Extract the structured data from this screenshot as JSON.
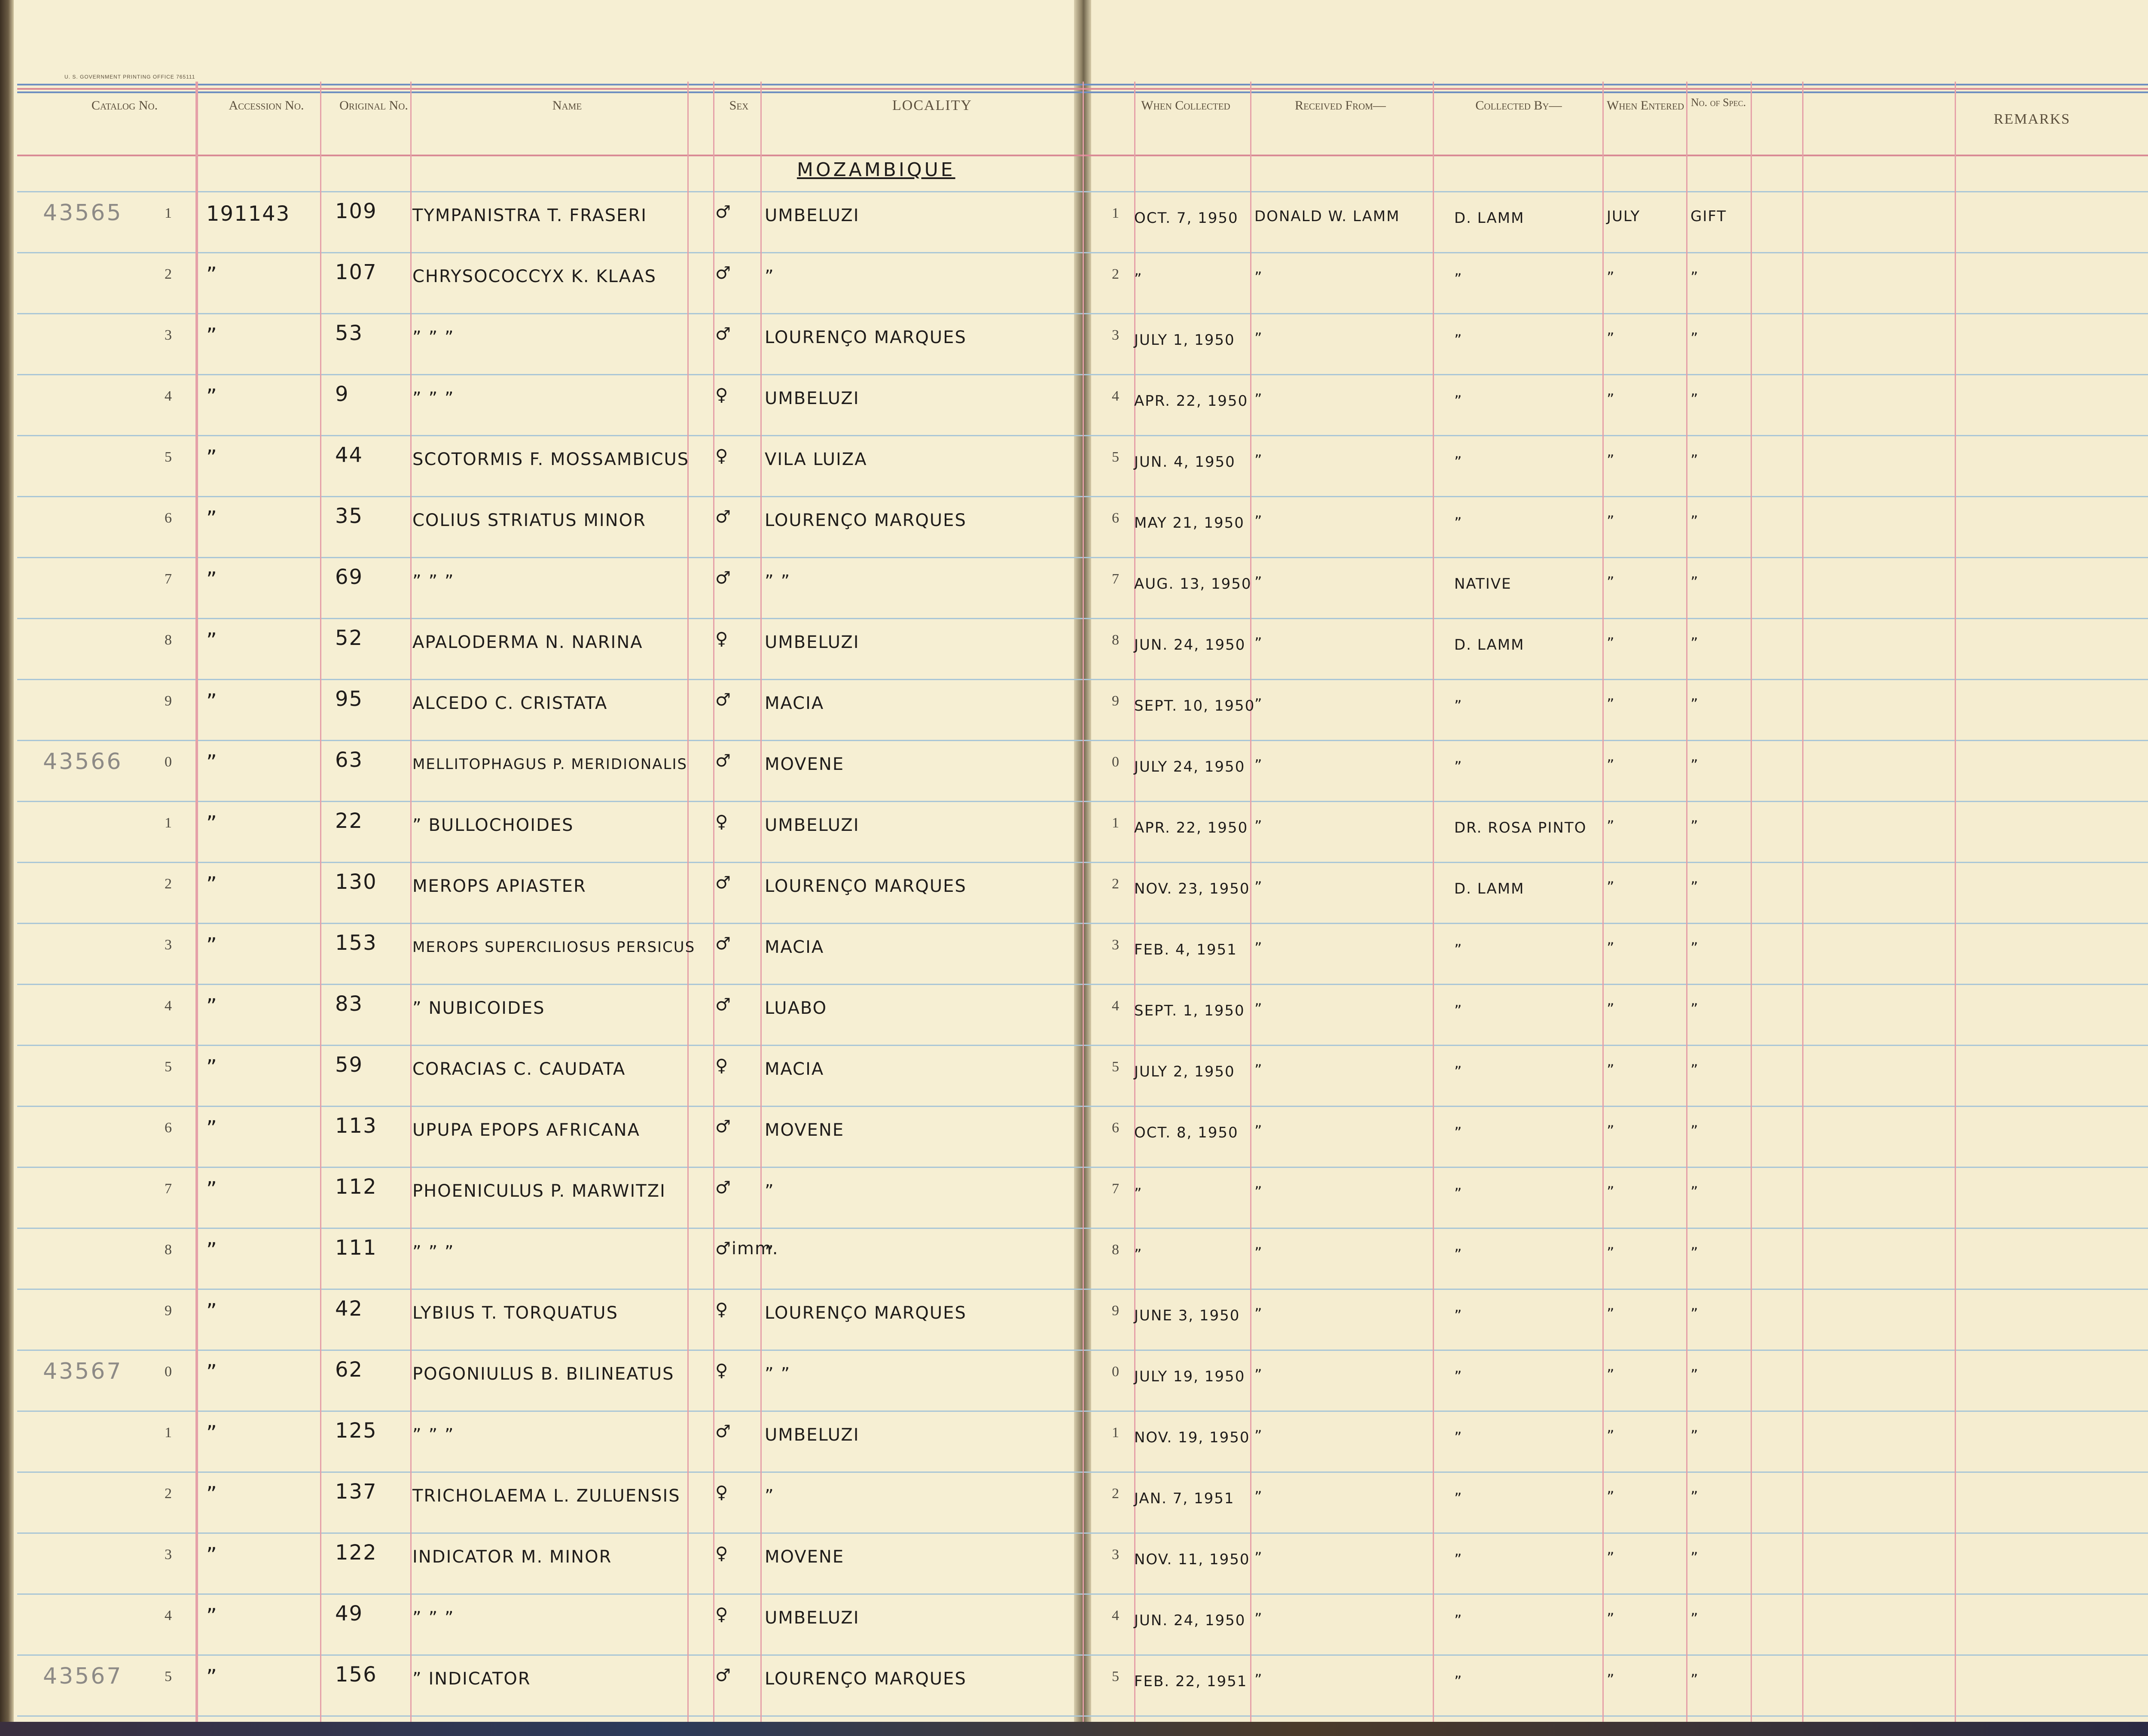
{
  "imprint": "U. S. GOVERNMENT PRINTING OFFICE   765111",
  "headers": {
    "catalog": "Catalog No.",
    "accession": "Accession No.",
    "original": "Original No.",
    "name": "Name",
    "sex": "Sex",
    "locality": "LOCALITY",
    "when_collected": "When Collected",
    "received_from": "Received From—",
    "collected_by": "Collected By—",
    "when_entered": "When Entered",
    "no_of_spec": "No. of Spec.",
    "remarks": "REMARKS"
  },
  "locality_heading": "MOZAMBIQUE",
  "rows": [
    {
      "catalog": "43565",
      "n": "1",
      "acc": "191143",
      "orig": "109",
      "name": "TYMPANISTRA T. FRASERI",
      "sex": "♂",
      "loc": "UMBELUZI",
      "rn": "1",
      "date": "OCT. 7, 1950",
      "recv": "DONALD W. LAMM",
      "coll": "D. LAMM",
      "entered": "JULY",
      "spec": "GIFT"
    },
    {
      "catalog": "",
      "n": "2",
      "acc": "”",
      "orig": "107",
      "name": "CHRYSOCOCCYX K. KLAAS",
      "sex": "♂",
      "loc": "”",
      "rn": "2",
      "date": "”",
      "recv": "”",
      "coll": "”",
      "entered": "”",
      "spec": "”"
    },
    {
      "catalog": "",
      "n": "3",
      "acc": "”",
      "orig": "53",
      "name": "”   ”   ”",
      "sex": "♂",
      "loc": "LOURENÇO MARQUES",
      "rn": "3",
      "date": "JULY 1, 1950",
      "recv": "”",
      "coll": "”",
      "entered": "”",
      "spec": "”"
    },
    {
      "catalog": "",
      "n": "4",
      "acc": "”",
      "orig": "9",
      "name": "”   ”   ”",
      "sex": "♀",
      "loc": "UMBELUZI",
      "rn": "4",
      "date": "APR. 22, 1950",
      "recv": "”",
      "coll": "”",
      "entered": "”",
      "spec": "”"
    },
    {
      "catalog": "",
      "n": "5",
      "acc": "”",
      "orig": "44",
      "name": "SCOTORMIS F. MOSSAMBICUS",
      "sex": "♀",
      "loc": "VILA LUIZA",
      "rn": "5",
      "date": "JUN. 4, 1950",
      "recv": "”",
      "coll": "”",
      "entered": "”",
      "spec": "”"
    },
    {
      "catalog": "",
      "n": "6",
      "acc": "”",
      "orig": "35",
      "name": "COLIUS STRIATUS MINOR",
      "sex": "♂",
      "loc": "LOURENÇO MARQUES",
      "rn": "6",
      "date": "MAY 21, 1950",
      "recv": "”",
      "coll": "”",
      "entered": "”",
      "spec": "”"
    },
    {
      "catalog": "",
      "n": "7",
      "acc": "”",
      "orig": "69",
      "name": "”   ”   ”",
      "sex": "♂",
      "loc": "”   ”",
      "rn": "7",
      "date": "AUG. 13, 1950",
      "recv": "”",
      "coll": "NATIVE",
      "entered": "”",
      "spec": "”"
    },
    {
      "catalog": "",
      "n": "8",
      "acc": "”",
      "orig": "52",
      "name": "APALODERMA N. NARINA",
      "sex": "♀",
      "loc": "UMBELUZI",
      "rn": "8",
      "date": "JUN. 24, 1950",
      "recv": "”",
      "coll": "D. LAMM",
      "entered": "”",
      "spec": "”"
    },
    {
      "catalog": "",
      "n": "9",
      "acc": "”",
      "orig": "95",
      "name": "ALCEDO C. CRISTATA",
      "sex": "♂",
      "loc": "MACIA",
      "rn": "9",
      "date": "SEPT. 10, 1950",
      "recv": "”",
      "coll": "”",
      "entered": "”",
      "spec": "”"
    },
    {
      "catalog": "43566",
      "n": "0",
      "acc": "”",
      "orig": "63",
      "name": "MELLITOPHAGUS P. MERIDIONALIS",
      "sex": "♂",
      "loc": "MOVENE",
      "rn": "0",
      "date": "JULY 24, 1950",
      "recv": "”",
      "coll": "”",
      "entered": "”",
      "spec": "”"
    },
    {
      "catalog": "",
      "n": "1",
      "acc": "”",
      "orig": "22",
      "name": "”   BULLOCHOIDES",
      "sex": "♀",
      "loc": "UMBELUZI",
      "rn": "1",
      "date": "APR. 22, 1950",
      "recv": "”",
      "coll": "DR. ROSA PINTO",
      "entered": "”",
      "spec": "”"
    },
    {
      "catalog": "",
      "n": "2",
      "acc": "”",
      "orig": "130",
      "name": "MEROPS APIASTER",
      "sex": "♂",
      "loc": "LOURENÇO MARQUES",
      "rn": "2",
      "date": "NOV. 23, 1950",
      "recv": "”",
      "coll": "D. LAMM",
      "entered": "”",
      "spec": "”"
    },
    {
      "catalog": "",
      "n": "3",
      "acc": "”",
      "orig": "153",
      "name": "MEROPS SUPERCILIOSUS PERSICUS",
      "sex": "♂",
      "loc": "MACIA",
      "rn": "3",
      "date": "FEB. 4, 1951",
      "recv": "”",
      "coll": "”",
      "entered": "”",
      "spec": "”"
    },
    {
      "catalog": "",
      "n": "4",
      "acc": "”",
      "orig": "83",
      "name": "”   NUBICOIDES",
      "sex": "♂",
      "loc": "LUABO",
      "rn": "4",
      "date": "SEPT. 1, 1950",
      "recv": "”",
      "coll": "”",
      "entered": "”",
      "spec": "”"
    },
    {
      "catalog": "",
      "n": "5",
      "acc": "”",
      "orig": "59",
      "name": "CORACIAS C. CAUDATA",
      "sex": "♀",
      "loc": "MACIA",
      "rn": "5",
      "date": "JULY 2, 1950",
      "recv": "”",
      "coll": "”",
      "entered": "”",
      "spec": "”"
    },
    {
      "catalog": "",
      "n": "6",
      "acc": "”",
      "orig": "113",
      "name": "UPUPA EPOPS AFRICANA",
      "sex": "♂",
      "loc": "MOVENE",
      "rn": "6",
      "date": "OCT. 8, 1950",
      "recv": "”",
      "coll": "”",
      "entered": "”",
      "spec": "”"
    },
    {
      "catalog": "",
      "n": "7",
      "acc": "”",
      "orig": "112",
      "name": "PHOENICULUS P. MARWITZI",
      "sex": "♂",
      "loc": "”",
      "rn": "7",
      "date": "”",
      "recv": "”",
      "coll": "”",
      "entered": "”",
      "spec": "”"
    },
    {
      "catalog": "",
      "n": "8",
      "acc": "”",
      "orig": "111",
      "name": "”   ”   ”",
      "sex": "♂imm.",
      "loc": "”",
      "rn": "8",
      "date": "”",
      "recv": "”",
      "coll": "”",
      "entered": "”",
      "spec": "”"
    },
    {
      "catalog": "",
      "n": "9",
      "acc": "”",
      "orig": "42",
      "name": "LYBIUS T. TORQUATUS",
      "sex": "♀",
      "loc": "LOURENÇO MARQUES",
      "rn": "9",
      "date": "JUNE 3, 1950",
      "recv": "”",
      "coll": "”",
      "entered": "”",
      "spec": "”"
    },
    {
      "catalog": "43567",
      "n": "0",
      "acc": "”",
      "orig": "62",
      "name": "POGONIULUS B. BILINEATUS",
      "sex": "♀",
      "loc": "”   ”",
      "rn": "0",
      "date": "JULY 19, 1950",
      "recv": "”",
      "coll": "”",
      "entered": "”",
      "spec": "”"
    },
    {
      "catalog": "",
      "n": "1",
      "acc": "”",
      "orig": "125",
      "name": "”   ”   ”",
      "sex": "♂",
      "loc": "UMBELUZI",
      "rn": "1",
      "date": "NOV. 19, 1950",
      "recv": "”",
      "coll": "”",
      "entered": "”",
      "spec": "”"
    },
    {
      "catalog": "",
      "n": "2",
      "acc": "”",
      "orig": "137",
      "name": "TRICHOLAEMA L. ZULUENSIS",
      "sex": "♀",
      "loc": "”",
      "rn": "2",
      "date": "JAN. 7, 1951",
      "recv": "”",
      "coll": "”",
      "entered": "”",
      "spec": "”"
    },
    {
      "catalog": "",
      "n": "3",
      "acc": "”",
      "orig": "122",
      "name": "INDICATOR M. MINOR",
      "sex": "♀",
      "loc": "MOVENE",
      "rn": "3",
      "date": "NOV. 11, 1950",
      "recv": "”",
      "coll": "”",
      "entered": "”",
      "spec": "”"
    },
    {
      "catalog": "",
      "n": "4",
      "acc": "”",
      "orig": "49",
      "name": "”   ”   ”",
      "sex": "♀",
      "loc": "UMBELUZI",
      "rn": "4",
      "date": "JUN. 24, 1950",
      "recv": "”",
      "coll": "”",
      "entered": "”",
      "spec": "”"
    },
    {
      "catalog": "43567",
      "n": "5",
      "acc": "”",
      "orig": "156",
      "name": "”   INDICATOR",
      "sex": "♂",
      "loc": "LOURENÇO MARQUES",
      "rn": "5",
      "date": "FEB. 22, 1951",
      "recv": "”",
      "coll": "”",
      "entered": "”",
      "spec": "”"
    }
  ]
}
